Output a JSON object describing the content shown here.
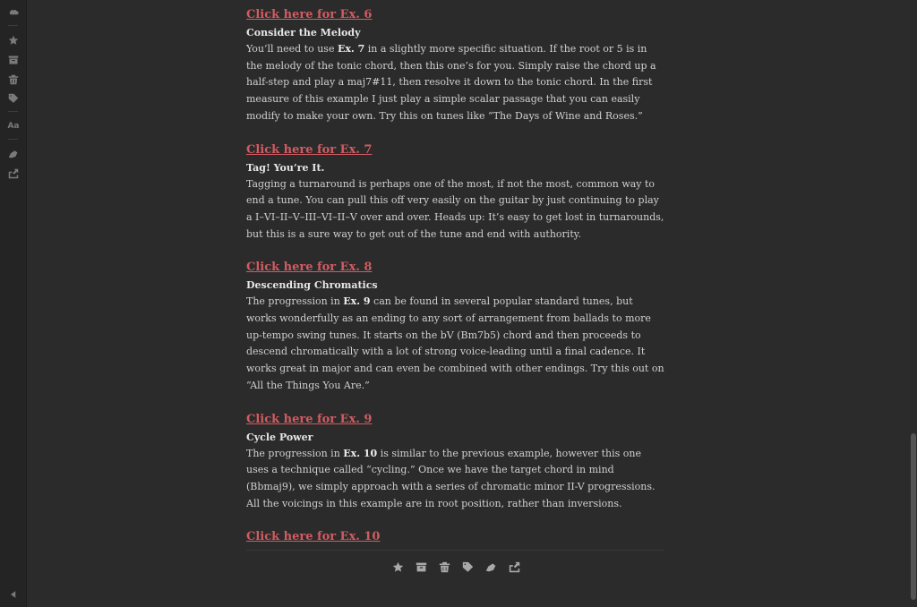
{
  "sidebar": {
    "items": [
      {
        "name": "pocket-logo-icon"
      },
      {
        "name": "favorite-star-icon"
      },
      {
        "name": "archive-icon"
      },
      {
        "name": "delete-trash-icon"
      },
      {
        "name": "tag-icon"
      },
      {
        "name": "font-settings-icon",
        "label": "Aa"
      },
      {
        "name": "highlighter-icon"
      },
      {
        "name": "share-icon"
      },
      {
        "name": "collapse-arrow-icon"
      }
    ]
  },
  "article": {
    "sections": [
      {
        "link": "Click here for Ex. 6",
        "title": "Consider the Melody",
        "p_before": "You’ll need to use ",
        "p_bold": "Ex. 7",
        "p_after": " in a slightly more specific situation. If the root or 5 is in the melody of the tonic chord, then this one’s for you. Simply raise the chord up a half-step and play a maj7#11, then resolve it down to the tonic chord. In the first measure of this example I just play a simple scalar passage that you can easily modify to make your own. Try this on tunes like “The Days of Wine and Roses.”"
      },
      {
        "link": "Click here for Ex. 7",
        "title": "Tag! You’re It.",
        "p_before": "Tagging a turnaround is perhaps one of the most, if not the most, common way to end a tune. You can pull this off very easily on the guitar by just continuing to play a I–VI–II–V–III–VI–II–V over and over. Heads up: It’s easy to get lost in turnarounds, but this is a sure way to get out of the tune and end with authority.",
        "p_bold": "",
        "p_after": ""
      },
      {
        "link": "Click here for Ex. 8",
        "title": "Descending Chromatics",
        "p_before": "The progression in ",
        "p_bold": "Ex. 9",
        "p_after": " can be found in several popular standard tunes, but works wonderfully as an ending to any sort of arrangement from ballads to more up-tempo swing tunes. It starts on the bV (Bm7b5) chord and then proceeds to descend chromatically with a lot of strong voice-leading until a final cadence. It works great in major and can even be combined with other endings. Try this out on “All the Things You Are.”"
      },
      {
        "link": "Click here for Ex. 9",
        "title": "Cycle Power",
        "p_before": "The progression in ",
        "p_bold": "Ex. 10",
        "p_after": " is similar to the previous example, however this one uses a technique called “cycling.” Once we have the target chord in mind (Bbmaj9), we simply approach with a series of chromatic minor II-V progressions. All the voicings in this example are in root position, rather than inversions."
      }
    ],
    "final_link": "Click here for Ex. 10"
  },
  "footer": {
    "icons": [
      "favorite-star-icon",
      "archive-icon",
      "delete-trash-icon",
      "tag-icon",
      "highlighter-icon",
      "share-icon"
    ]
  }
}
